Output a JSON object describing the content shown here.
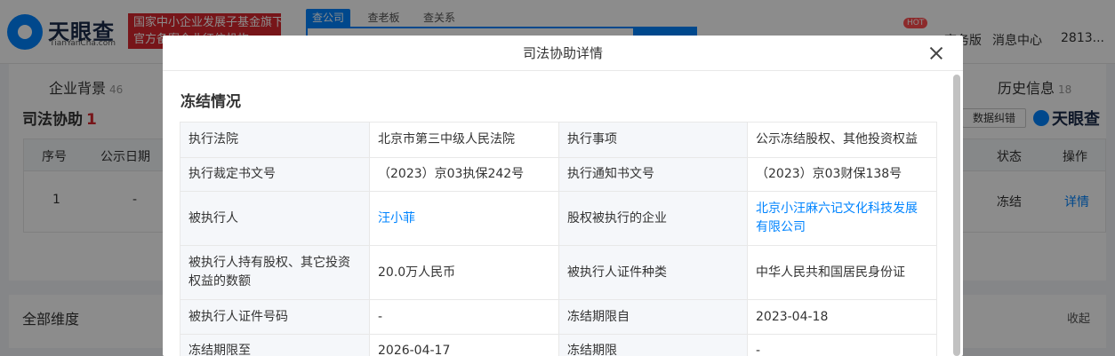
{
  "header": {
    "logo_cn": "天眼查",
    "logo_en": "TianYanCha.com",
    "fund_line1": "国家中小企业发展子基金旗下",
    "fund_line2": "官方备案企业征信机构",
    "search_tabs": [
      "查公司",
      "查老板",
      "查关系"
    ],
    "hot_label": "HOT",
    "nav_items": [
      "商务版",
      "消息中心",
      "2813..."
    ]
  },
  "subnav": {
    "items": [
      {
        "label": "企业背景",
        "count": "46"
      },
      {
        "label": "历史信息",
        "count": "18"
      }
    ]
  },
  "section": {
    "title": "司法协助",
    "count": "1",
    "report_btn": "数据纠错",
    "watermark": "天眼查",
    "columns": [
      "序号",
      "公示日期",
      "状态",
      "操作"
    ],
    "row": {
      "index": "1",
      "date": "-",
      "status": "冻结",
      "action": "详情"
    }
  },
  "dimensions": {
    "title": "全部维度",
    "collapse": "收起"
  },
  "modal": {
    "title": "司法协助详情",
    "heading": "冻结情况",
    "rows": [
      [
        "执行法院",
        "北京市第三中级人民法院",
        "执行事项",
        "公示冻结股权、其他投资权益"
      ],
      [
        "执行裁定书文号",
        "（2023）京03执保242号",
        "执行通知书文号",
        "（2023）京03财保138号"
      ],
      [
        "被执行人",
        "汪小菲",
        "股权被执行的企业",
        "北京小汪麻六记文化科技发展有限公司"
      ],
      [
        "被执行人持有股权、其它投资权益的数额",
        "20.0万人民币",
        "被执行人证件种类",
        "中华人民共和国居民身份证"
      ],
      [
        "被执行人证件号码",
        "-",
        "冻结期限自",
        "2023-04-18"
      ],
      [
        "冻结期限至",
        "2026-04-17",
        "冻结期限",
        "-"
      ]
    ]
  },
  "colors": {
    "brand_blue": "#0084ff",
    "brand_red": "#d9272e",
    "label_bg": "#f5f7fa"
  }
}
